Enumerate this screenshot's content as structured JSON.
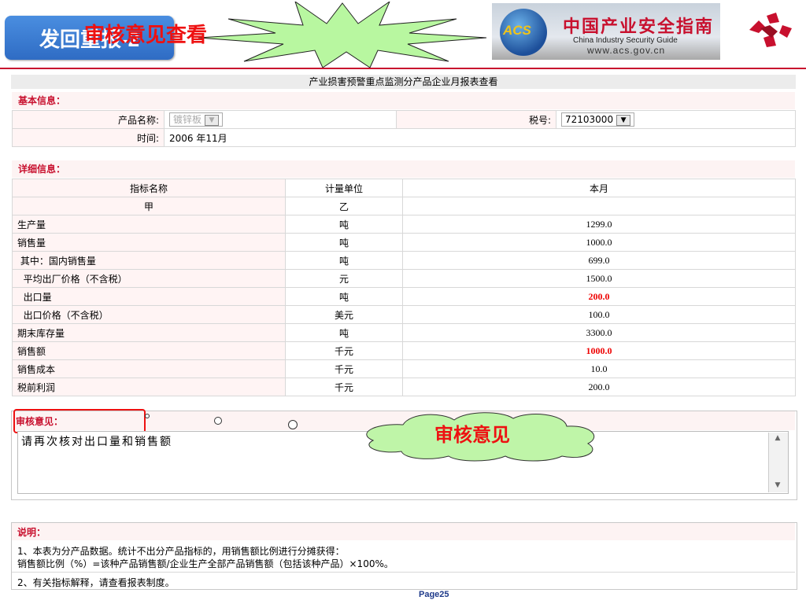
{
  "slide": {
    "tag": "发回重报-2",
    "callout_title": "审核意见查看",
    "page": "Page25"
  },
  "logo": {
    "acs": "ACS",
    "cn": "中国产业安全指南",
    "en": "China  Industry  Security  Guide",
    "url": "www.acs.gov.cn"
  },
  "report": {
    "title": "产业损害预警重点监测分产品企业月报表查看",
    "basic_label": "基本信息：",
    "product_label": "产品名称:",
    "product_value": "镀锌板",
    "tax_label": "税号:",
    "tax_value": "72103000",
    "time_label": "时间:",
    "time_value": "2006 年11月",
    "detail_label": "详细信息：",
    "columns": [
      "指标名称",
      "计量单位",
      "本月"
    ],
    "sub_columns": [
      "甲",
      "乙",
      ""
    ],
    "rows": [
      {
        "name": "生产量",
        "unit": "吨",
        "value": "1299.0",
        "highlight": false
      },
      {
        "name": "销售量",
        "unit": "吨",
        "value": "1000.0",
        "highlight": false
      },
      {
        "name": " 其中：国内销售量",
        "unit": "吨",
        "value": "699.0",
        "highlight": false
      },
      {
        "name": "  平均出厂价格（不含税）",
        "unit": "元",
        "value": "1500.0",
        "highlight": false
      },
      {
        "name": "  出口量",
        "unit": "吨",
        "value": "200.0",
        "highlight": true
      },
      {
        "name": "  出口价格（不含税）",
        "unit": "美元",
        "value": "100.0",
        "highlight": false
      },
      {
        "name": "期末库存量",
        "unit": "吨",
        "value": "3300.0",
        "highlight": false
      },
      {
        "name": "销售额",
        "unit": "千元",
        "value": "1000.0",
        "highlight": true
      },
      {
        "name": "销售成本",
        "unit": "千元",
        "value": "10.0",
        "highlight": false
      },
      {
        "name": "税前利润",
        "unit": "千元",
        "value": "200.0",
        "highlight": false
      }
    ]
  },
  "review": {
    "label": "审核意见：",
    "text": "请再次核对出口量和销售额",
    "cloud": "审核意见"
  },
  "notes": {
    "label": "说明：",
    "line1": "1、本表为分产品数据。统计不出分产品指标的，用销售额比例进行分摊获得：",
    "line2": "销售额比例（%）=该种产品销售额/企业生产全部产品销售额（包括该种产品）×100%。",
    "line3": "2、有关指标解释，请查看报表制度。"
  },
  "colors": {
    "accent_red": "#c8102e",
    "tag_blue": "#3a7bd5",
    "cloud_green": "#bff5a8",
    "star_green": "#b8f7a0"
  }
}
